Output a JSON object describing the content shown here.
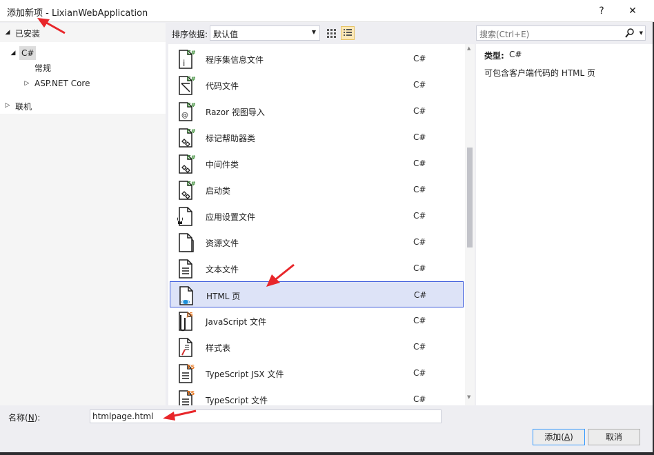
{
  "window": {
    "title": "添加新项 - LixianWebApplication",
    "help_label": "?",
    "close_label": "✕"
  },
  "left": {
    "installed_label": "已安装",
    "tree": [
      {
        "label": "C#",
        "expanded": true
      },
      {
        "label": "常规"
      },
      {
        "label": "ASP.NET Core",
        "expanded": false
      }
    ],
    "online_label": "联机"
  },
  "toolbar": {
    "sort_label": "排序依据:",
    "sort_value": "默认值"
  },
  "search": {
    "placeholder": "搜索(Ctrl+E)"
  },
  "templates": [
    {
      "name": "程序集信息文件",
      "lang": "C#",
      "icon": "assembly-info-icon"
    },
    {
      "name": "代码文件",
      "lang": "C#",
      "icon": "code-file-icon"
    },
    {
      "name": "Razor 视图导入",
      "lang": "C#",
      "icon": "razor-view-import-icon"
    },
    {
      "name": "标记帮助器类",
      "lang": "C#",
      "icon": "tag-helper-class-icon"
    },
    {
      "name": "中间件类",
      "lang": "C#",
      "icon": "middleware-class-icon"
    },
    {
      "name": "启动类",
      "lang": "C#",
      "icon": "startup-class-icon"
    },
    {
      "name": "应用设置文件",
      "lang": "C#",
      "icon": "app-settings-icon"
    },
    {
      "name": "资源文件",
      "lang": "C#",
      "icon": "resource-file-icon"
    },
    {
      "name": "文本文件",
      "lang": "C#",
      "icon": "text-file-icon"
    },
    {
      "name": "HTML 页",
      "lang": "C#",
      "icon": "html-page-icon",
      "selected": true
    },
    {
      "name": "JavaScript 文件",
      "lang": "C#",
      "icon": "javascript-file-icon"
    },
    {
      "name": "样式表",
      "lang": "C#",
      "icon": "stylesheet-icon"
    },
    {
      "name": "TypeScript JSX 文件",
      "lang": "C#",
      "icon": "typescript-jsx-icon"
    },
    {
      "name": "TypeScript 文件",
      "lang": "C#",
      "icon": "typescript-file-icon"
    }
  ],
  "details": {
    "type_label": "类型:",
    "type_value": "C#",
    "description": "可包含客户端代码的 HTML 页"
  },
  "bottom": {
    "name_label_pre": "名称(",
    "name_label_key": "N",
    "name_label_post": "):",
    "name_value": "htmlpage.html",
    "add_pre": "添加(",
    "add_key": "A",
    "add_post": ")",
    "cancel_label": "取消"
  },
  "colors": {
    "accent": "#3b5bdb",
    "selection_bg": "#dde3f7",
    "csharp_green": "#388a34",
    "typescript_orange": "#e8761f",
    "annotation_red": "#e8262a"
  }
}
